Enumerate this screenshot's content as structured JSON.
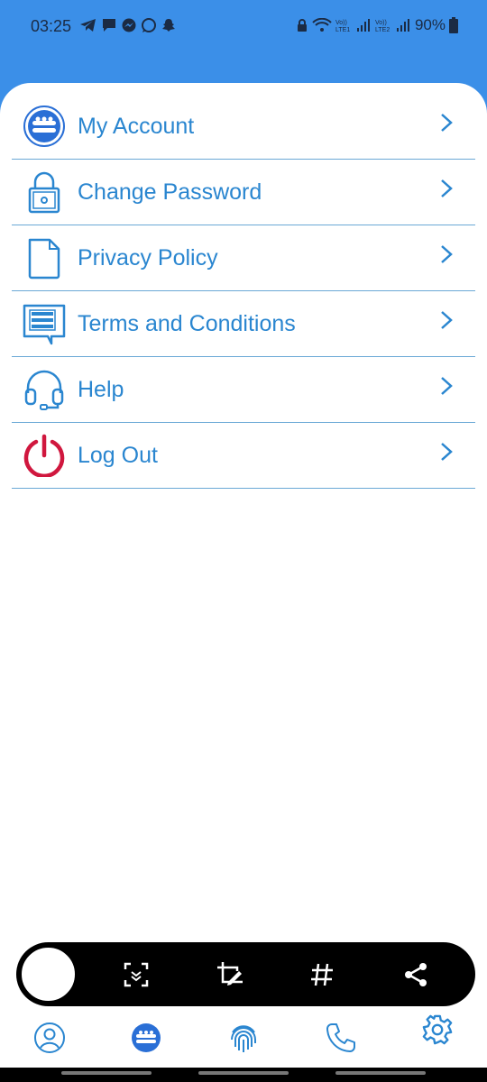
{
  "status_bar": {
    "time": "03:25",
    "battery": "90%",
    "left_icons": [
      "telegram-icon",
      "message-icon",
      "messenger-icon",
      "whatsapp-icon",
      "snapchat-icon"
    ],
    "right_icons": [
      "lock-icon",
      "wifi-icon",
      "signal-lte1-icon",
      "signal-lte2-icon",
      "battery-icon"
    ],
    "lte1": "LTE1",
    "lte2": "LTE2"
  },
  "colors": {
    "header": "#3b8fe8",
    "accent": "#2a86d0",
    "logout": "#d0173e",
    "divider": "#6aa8d6"
  },
  "menu": {
    "items": [
      {
        "label": "My Account",
        "icon": "app-logo-icon"
      },
      {
        "label": "Change Password",
        "icon": "padlock-icon"
      },
      {
        "label": "Privacy Policy",
        "icon": "document-icon"
      },
      {
        "label": "Terms and Conditions",
        "icon": "terms-list-icon"
      },
      {
        "label": "Help",
        "icon": "headset-icon"
      },
      {
        "label": "Log Out",
        "icon": "power-icon"
      }
    ]
  },
  "toolbar": {
    "buttons": [
      "scan-icon",
      "crop-edit-icon",
      "hashtag-icon",
      "share-icon"
    ]
  },
  "bottom_nav": {
    "items": [
      "profile-icon",
      "home-logo-icon",
      "fingerprint-icon",
      "phone-icon",
      "settings-gear-icon"
    ],
    "active": "settings-gear-icon"
  }
}
